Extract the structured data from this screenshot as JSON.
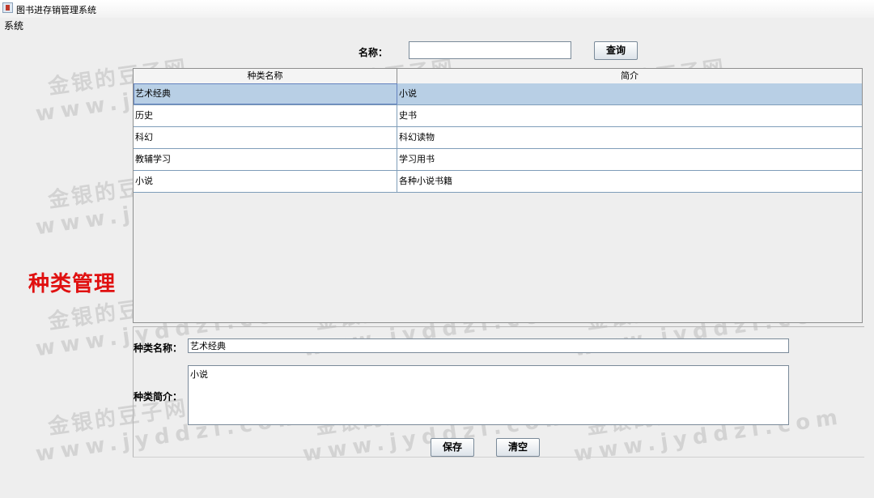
{
  "window": {
    "title": "图书进存销管理系统"
  },
  "menu": {
    "items": [
      "系统"
    ]
  },
  "search": {
    "label": "名称：",
    "value": "",
    "button": "查询"
  },
  "side_title": "种类管理",
  "table": {
    "columns": [
      "种类名称",
      "简介"
    ],
    "rows": [
      [
        "艺术经典",
        "小说"
      ],
      [
        "历史",
        "史书"
      ],
      [
        "科幻",
        "科幻读物"
      ],
      [
        "教辅学习",
        "学习用书"
      ],
      [
        "小说",
        "各种小说书籍"
      ]
    ],
    "selected_row": 0
  },
  "form": {
    "name_label": "种类名称：",
    "name_value": "艺术经典",
    "desc_label": "种类简介：",
    "desc_value": "小说",
    "save_button": "保存",
    "clear_button": "清空"
  },
  "watermark": {
    "line1": "金银的豆子网",
    "line2": "www.jyddzi.com"
  }
}
